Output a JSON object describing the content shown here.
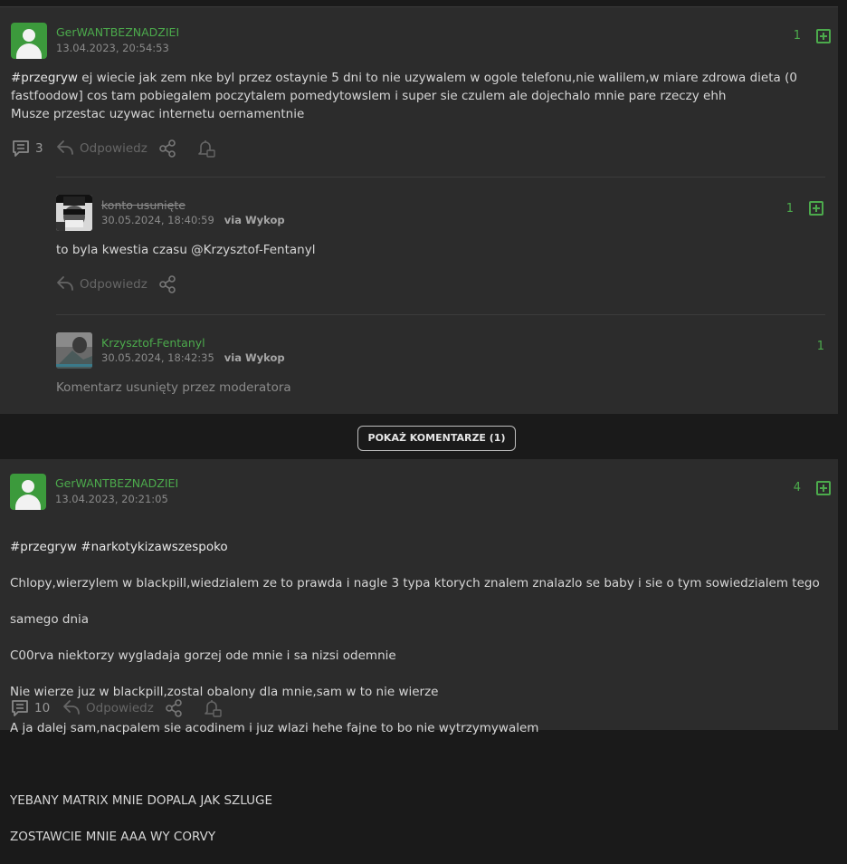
{
  "post1": {
    "author": "GerWANTBEZNADZIEI",
    "date": "13.04.2023, 20:54:53",
    "votes": "1",
    "tag": "#przegryw",
    "body_line1": " ej wiecie jak zem nke byl przez ostaynie 5 dni to nie uzywalem w ogole telefonu,nie walilem,w miare zdrowa dieta (0",
    "body_line2": "fastfoodow] cos tam pobiegalem poczytalem pomedytowslem i super sie czulem ale dojechalo mnie pare rzeczy ehh",
    "body_line3": "Musze przestac uzywac internetu oernamentnie",
    "comments_count": "3",
    "reply_label": "Odpowiedz"
  },
  "comment1": {
    "author": "konto usunięte",
    "date": "30.05.2024, 18:40:59",
    "via": "via Wykop",
    "votes": "1",
    "body": "to byla kwestia czasu @Krzysztof-Fentanyl",
    "reply_label": "Odpowiedz"
  },
  "comment2": {
    "author": "Krzysztof-Fentanyl",
    "date": "30.05.2024, 18:42:35",
    "via": "via Wykop",
    "votes": "1",
    "body": "Komentarz usunięty przez moderatora"
  },
  "show_comments_label": "POKAŻ KOMENTARZE (1)",
  "post2": {
    "author": "GerWANTBEZNADZIEI",
    "date": "13.04.2023, 20:21:05",
    "votes": "4",
    "tags": "#przegryw #narkotykizawszespoko",
    "lines": [
      "Chlopy,wierzylem w blackpill,wiedzialem ze to prawda i nagle 3 typa ktorych znalem znalazlo se baby i sie o tym sowiedzialem tego",
      "samego dnia",
      "C00rva niektorzy wygladaja gorzej ode mnie i sa nizsi odemnie",
      "Nie wierze juz w blackpill,zostal obalony dla mnie,sam w to nie wierze",
      "A ja dalej sam,nacpalem sie acodinem i juz wlazi hehe fajne to bo nie wytrzymywalem",
      "",
      "YEBANY MATRIX MNIE DOPALA JAK SZLUGE",
      "ZOSTAWCIE MNIE AAA WY CORVY"
    ],
    "comments_count": "10",
    "reply_label": "Odpowiedz"
  },
  "icons": {
    "comments": "comments-icon",
    "reply": "reply-arrow-icon",
    "share": "share-icon",
    "notify": "bell-icon",
    "plus": "plus-square-icon"
  },
  "colors": {
    "accent": "#4caa4c",
    "background": "#1a1a1a",
    "card": "#2c2c2c"
  }
}
